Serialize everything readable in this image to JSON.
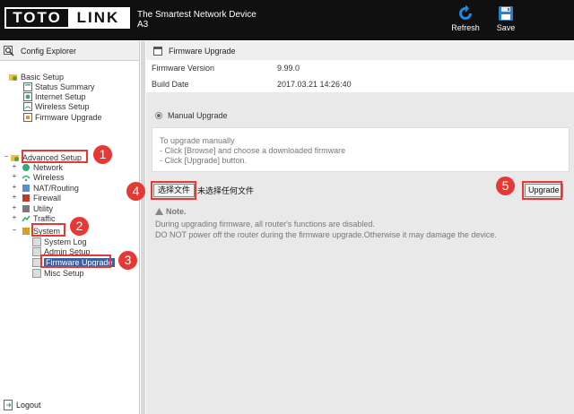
{
  "header": {
    "logo_left": "TOTO",
    "logo_right": "LINK",
    "tagline": "The Smartest Network Device",
    "model": "A3",
    "refresh_label": "Refresh",
    "save_label": "Save"
  },
  "sidebar": {
    "title": "Config Explorer",
    "basic_setup": "Basic Setup",
    "basic_items": [
      "Status Summary",
      "Internet Setup",
      "Wireless Setup",
      "Firmware Upgrade"
    ],
    "advanced_setup": "Advanced Setup",
    "advanced_items": [
      "Network",
      "Wireless",
      "NAT/Routing",
      "Firewall",
      "Utility",
      "Traffic",
      "System"
    ],
    "system_items": [
      "System Log",
      "Admin Setup",
      "Firmware Upgrade",
      "Misc Setup"
    ],
    "logout": "Logout"
  },
  "annotations": [
    "1",
    "2",
    "3",
    "4",
    "5"
  ],
  "main": {
    "title": "Firmware Upgrade",
    "firmware_version_label": "Firmware Version",
    "firmware_version": "9.99.0",
    "build_date_label": "Build Date",
    "build_date": "2017.03.21 14:26:40",
    "manual_upgrade": "Manual Upgrade",
    "instructions": [
      "To upgrade manually",
      "- Click [Browse] and choose a downloaded firmware",
      "- Click [Upgrade] button."
    ],
    "choose_file": "选择文件",
    "no_file": "未选择任何文件",
    "upgrade": "Upgrade",
    "note_title": "Note.",
    "note_lines": [
      "During upgrading firmware, all router's functions are disabled.",
      "DO NOT power off the router during the firmware upgrade.Otherwise it may damage the device."
    ]
  },
  "colors": {
    "header_bg": "#101010",
    "highlight": "#e53935",
    "selected": "#3f5fa0",
    "panel_bg": "#e9e9e9"
  }
}
